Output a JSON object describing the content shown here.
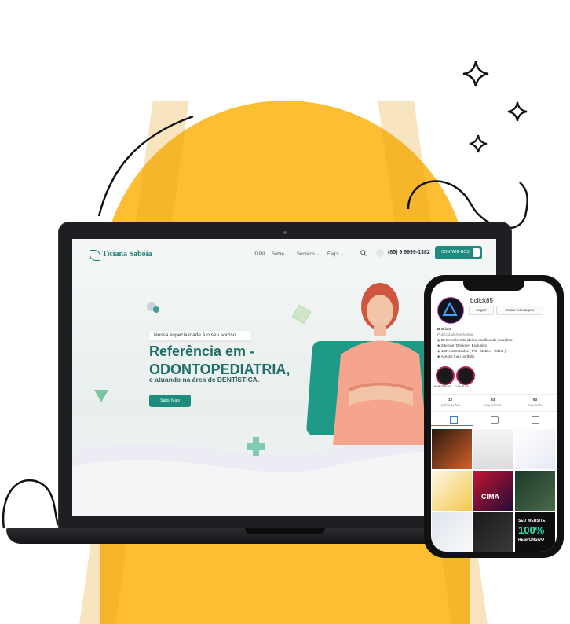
{
  "site": {
    "brand": "Ticiana Sabóia",
    "menu": [
      "Início",
      "Sobre ⌄",
      "Serviços ⌄",
      "Faq's ⌄"
    ],
    "phone": "(85) 9 9999-1382",
    "cta_label": "CONTATE-NOS",
    "tagline": "Nossa especialidade é o seu sorriso.",
    "heading_line1": "Referência em -",
    "heading_line2": "ODONTOPEDIATRIA,",
    "subheading": "e atuando na área de DENTÍSTICA.",
    "button_label": "Saiba Mais"
  },
  "instagram": {
    "username": "bclick85",
    "follow": "Seguir",
    "message": "Enviar mensagem",
    "name": "B-Click!",
    "category": "Publicidade/marketing",
    "bio": [
      "Desenvolvendo ideias, codificando soluções.",
      "Site com Designer Exclusivo",
      "100% otimizados ( PC - Mobile - Tablet )",
      "Acesse meu portfólio"
    ],
    "highlights": [
      "PARCERIAS",
      "O QUE FA..."
    ],
    "stats": [
      {
        "value": "12",
        "label": "publicações"
      },
      {
        "value": "33",
        "label": "seguidores"
      },
      {
        "value": "93",
        "label": "seguindo"
      }
    ],
    "thumb_texts": [
      "SEU WEBSITE",
      "100%",
      "RESPONSIVO",
      "CIMA"
    ]
  },
  "colors": {
    "yellow": "#FDBE33",
    "teal": "#1f8a7e"
  }
}
